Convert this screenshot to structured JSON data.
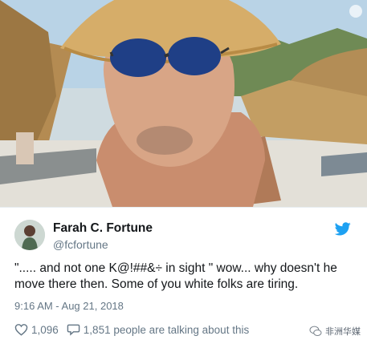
{
  "tweet": {
    "author_name": "Farah C. Fortune",
    "handle": "@fcfortune",
    "text": "\"..... and not one K@!##&÷ in sight \" wow... why doesn't he move there then. Some of you white folks are tiring.",
    "timestamp": "9:16 AM - Aug 21, 2018",
    "likes": "1,096",
    "talking_about": "1,851 people are talking about this"
  },
  "watermark": {
    "text": "非洲华媒"
  },
  "colors": {
    "twitter_blue": "#1da1f2",
    "text": "#14171a",
    "secondary": "#657786"
  },
  "icons": {
    "brand": "twitter-bird-icon",
    "like": "heart-icon",
    "reply": "speech-bubble-icon",
    "watermark": "wechat-icon",
    "corner": "info-icon"
  }
}
